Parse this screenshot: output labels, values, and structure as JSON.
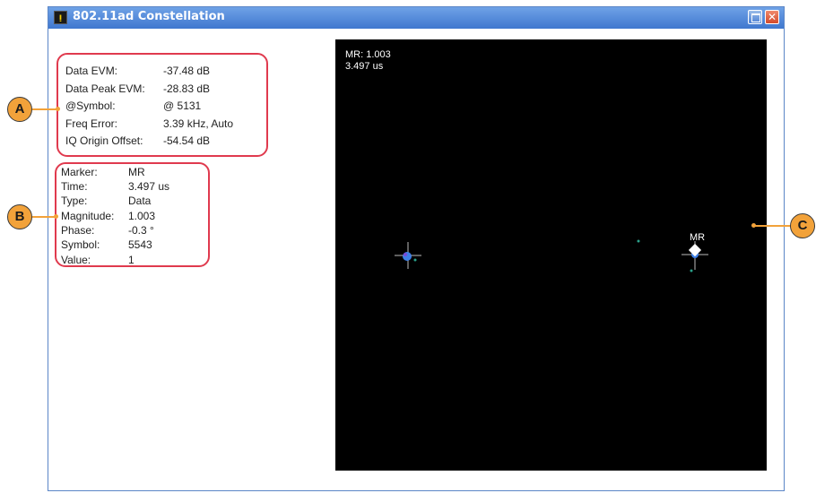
{
  "window": {
    "title": "802.11ad Constellation",
    "app_icon": "tek-app-icon"
  },
  "summary": [
    {
      "label": "Data EVM:",
      "value": "-37.48 dB"
    },
    {
      "label": "Data Peak EVM:",
      "value": "-28.83 dB"
    },
    {
      "label": "@Symbol:",
      "value": "@ 5131"
    },
    {
      "label": "Freq Error:",
      "value": "3.39 kHz, Auto"
    },
    {
      "label": "IQ Origin Offset:",
      "value": "-54.54 dB"
    }
  ],
  "marker": [
    {
      "label": "Marker:",
      "value": "MR"
    },
    {
      "label": "Time:",
      "value": "3.497 us"
    },
    {
      "label": "Type:",
      "value": "Data"
    },
    {
      "label": "Magnitude:",
      "value": "1.003"
    },
    {
      "label": "Phase:",
      "value": "-0.3 °"
    },
    {
      "label": "Symbol:",
      "value": "5543"
    },
    {
      "label": "Value:",
      "value": "1"
    }
  ],
  "plot": {
    "readout_line1": "MR: 1.003",
    "readout_line2": "3.497 us",
    "marker_label": "MR"
  },
  "callouts": {
    "a": "A",
    "b": "B",
    "c": "C"
  },
  "colors": {
    "callout_border": "#e03a4e",
    "callout_fill": "#f2a23a",
    "plot_bg": "#000000",
    "point_blue": "#3d7fe6",
    "titlebar": "#4f85d6"
  }
}
